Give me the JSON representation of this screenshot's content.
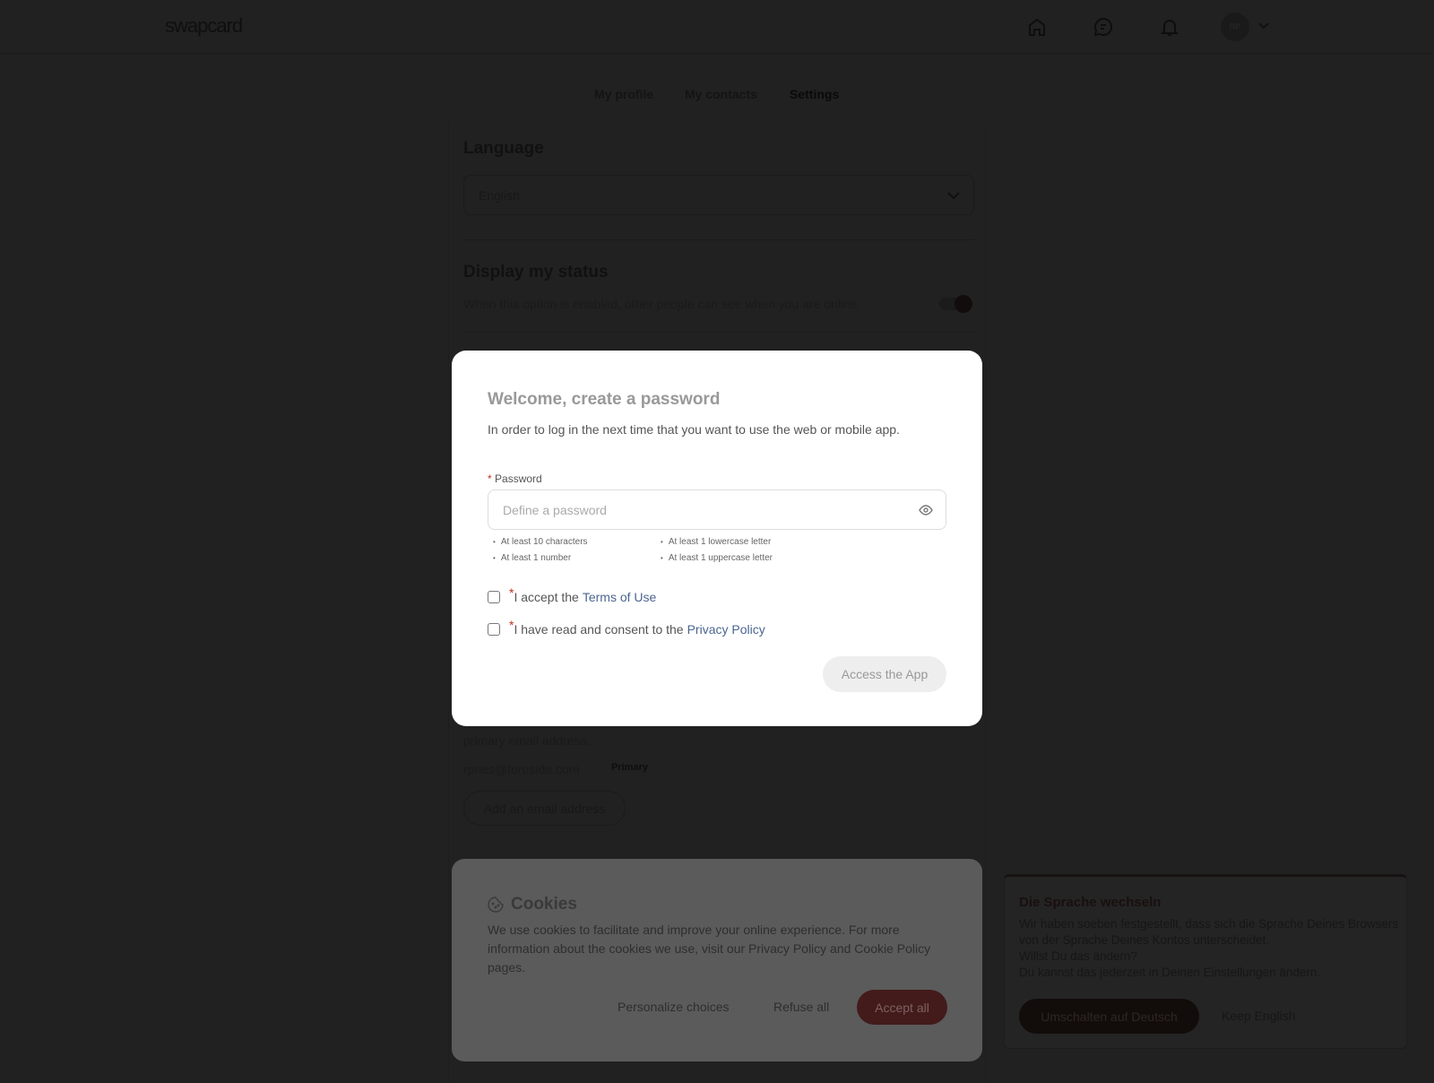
{
  "header": {
    "logo": "swapcard",
    "avatar_initials": "RP",
    "icons": [
      "home-icon",
      "chat-icon",
      "bell-icon",
      "chevron-down-icon"
    ]
  },
  "tabs": [
    {
      "label": "My profile"
    },
    {
      "label": "My contacts"
    },
    {
      "label": "Settings",
      "active": true
    }
  ],
  "settings": {
    "language": {
      "title": "Language",
      "value": "English"
    },
    "status": {
      "title": "Display my status",
      "description": "When this option is enabled, other people can see when you are online.",
      "enabled": true
    },
    "emails": {
      "note_tail": "primary email address.",
      "email": "rpries@foreside.com",
      "badge": "Primary",
      "add_button": "Add an email address"
    }
  },
  "modal": {
    "title": "Welcome, create a password",
    "description": "In order to log in the next time that you want to use the web or mobile app.",
    "password_label": "Password",
    "password_placeholder": "Define a password",
    "rules": [
      "At least 10 characters",
      "At least 1 lowercase letter",
      "At least 1 number",
      "At least 1 uppercase letter"
    ],
    "terms_prefix": "I accept the",
    "terms_link": "Terms of Use",
    "privacy_prefix": "I have read and consent to the",
    "privacy_link": "Privacy Policy",
    "submit": "Access the App"
  },
  "cookies": {
    "title": "Cookies",
    "description": "We use cookies to facilitate and improve your online experience. For more information about the cookies we use, visit our Privacy Policy and Cookie Policy pages.",
    "personalize": "Personalize choices",
    "refuse": "Refuse all",
    "accept": "Accept all"
  },
  "language_popup": {
    "title": "Die Sprache wechseln",
    "lines": [
      "Wir haben soeben festgestellt, dass sich die Sprache Deines Browsers von der Sprache Deines Kontos unterscheidet.",
      "Willst Du das ändern?",
      "Du kannst das jederzeit in Deinen Einstellungen ändern."
    ],
    "switch": "Umschalten auf Deutsch",
    "keep": "Keep English"
  },
  "colors": {
    "overlay": "#212121",
    "accent": "#431b1b",
    "link": "#4b6590",
    "required": "#c0311f"
  }
}
